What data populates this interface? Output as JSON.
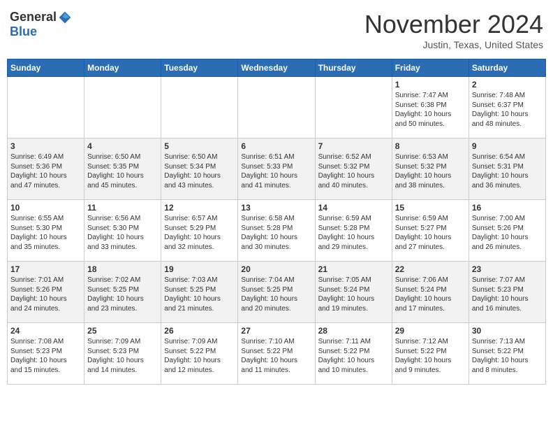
{
  "header": {
    "logo_general": "General",
    "logo_blue": "Blue",
    "month": "November 2024",
    "location": "Justin, Texas, United States"
  },
  "days_of_week": [
    "Sunday",
    "Monday",
    "Tuesday",
    "Wednesday",
    "Thursday",
    "Friday",
    "Saturday"
  ],
  "weeks": [
    [
      {
        "day": "",
        "info": ""
      },
      {
        "day": "",
        "info": ""
      },
      {
        "day": "",
        "info": ""
      },
      {
        "day": "",
        "info": ""
      },
      {
        "day": "",
        "info": ""
      },
      {
        "day": "1",
        "info": "Sunrise: 7:47 AM\nSunset: 6:38 PM\nDaylight: 10 hours\nand 50 minutes."
      },
      {
        "day": "2",
        "info": "Sunrise: 7:48 AM\nSunset: 6:37 PM\nDaylight: 10 hours\nand 48 minutes."
      }
    ],
    [
      {
        "day": "3",
        "info": "Sunrise: 6:49 AM\nSunset: 5:36 PM\nDaylight: 10 hours\nand 47 minutes."
      },
      {
        "day": "4",
        "info": "Sunrise: 6:50 AM\nSunset: 5:35 PM\nDaylight: 10 hours\nand 45 minutes."
      },
      {
        "day": "5",
        "info": "Sunrise: 6:50 AM\nSunset: 5:34 PM\nDaylight: 10 hours\nand 43 minutes."
      },
      {
        "day": "6",
        "info": "Sunrise: 6:51 AM\nSunset: 5:33 PM\nDaylight: 10 hours\nand 41 minutes."
      },
      {
        "day": "7",
        "info": "Sunrise: 6:52 AM\nSunset: 5:32 PM\nDaylight: 10 hours\nand 40 minutes."
      },
      {
        "day": "8",
        "info": "Sunrise: 6:53 AM\nSunset: 5:32 PM\nDaylight: 10 hours\nand 38 minutes."
      },
      {
        "day": "9",
        "info": "Sunrise: 6:54 AM\nSunset: 5:31 PM\nDaylight: 10 hours\nand 36 minutes."
      }
    ],
    [
      {
        "day": "10",
        "info": "Sunrise: 6:55 AM\nSunset: 5:30 PM\nDaylight: 10 hours\nand 35 minutes."
      },
      {
        "day": "11",
        "info": "Sunrise: 6:56 AM\nSunset: 5:30 PM\nDaylight: 10 hours\nand 33 minutes."
      },
      {
        "day": "12",
        "info": "Sunrise: 6:57 AM\nSunset: 5:29 PM\nDaylight: 10 hours\nand 32 minutes."
      },
      {
        "day": "13",
        "info": "Sunrise: 6:58 AM\nSunset: 5:28 PM\nDaylight: 10 hours\nand 30 minutes."
      },
      {
        "day": "14",
        "info": "Sunrise: 6:59 AM\nSunset: 5:28 PM\nDaylight: 10 hours\nand 29 minutes."
      },
      {
        "day": "15",
        "info": "Sunrise: 6:59 AM\nSunset: 5:27 PM\nDaylight: 10 hours\nand 27 minutes."
      },
      {
        "day": "16",
        "info": "Sunrise: 7:00 AM\nSunset: 5:26 PM\nDaylight: 10 hours\nand 26 minutes."
      }
    ],
    [
      {
        "day": "17",
        "info": "Sunrise: 7:01 AM\nSunset: 5:26 PM\nDaylight: 10 hours\nand 24 minutes."
      },
      {
        "day": "18",
        "info": "Sunrise: 7:02 AM\nSunset: 5:25 PM\nDaylight: 10 hours\nand 23 minutes."
      },
      {
        "day": "19",
        "info": "Sunrise: 7:03 AM\nSunset: 5:25 PM\nDaylight: 10 hours\nand 21 minutes."
      },
      {
        "day": "20",
        "info": "Sunrise: 7:04 AM\nSunset: 5:25 PM\nDaylight: 10 hours\nand 20 minutes."
      },
      {
        "day": "21",
        "info": "Sunrise: 7:05 AM\nSunset: 5:24 PM\nDaylight: 10 hours\nand 19 minutes."
      },
      {
        "day": "22",
        "info": "Sunrise: 7:06 AM\nSunset: 5:24 PM\nDaylight: 10 hours\nand 17 minutes."
      },
      {
        "day": "23",
        "info": "Sunrise: 7:07 AM\nSunset: 5:23 PM\nDaylight: 10 hours\nand 16 minutes."
      }
    ],
    [
      {
        "day": "24",
        "info": "Sunrise: 7:08 AM\nSunset: 5:23 PM\nDaylight: 10 hours\nand 15 minutes."
      },
      {
        "day": "25",
        "info": "Sunrise: 7:09 AM\nSunset: 5:23 PM\nDaylight: 10 hours\nand 14 minutes."
      },
      {
        "day": "26",
        "info": "Sunrise: 7:09 AM\nSunset: 5:22 PM\nDaylight: 10 hours\nand 12 minutes."
      },
      {
        "day": "27",
        "info": "Sunrise: 7:10 AM\nSunset: 5:22 PM\nDaylight: 10 hours\nand 11 minutes."
      },
      {
        "day": "28",
        "info": "Sunrise: 7:11 AM\nSunset: 5:22 PM\nDaylight: 10 hours\nand 10 minutes."
      },
      {
        "day": "29",
        "info": "Sunrise: 7:12 AM\nSunset: 5:22 PM\nDaylight: 10 hours\nand 9 minutes."
      },
      {
        "day": "30",
        "info": "Sunrise: 7:13 AM\nSunset: 5:22 PM\nDaylight: 10 hours\nand 8 minutes."
      }
    ]
  ]
}
